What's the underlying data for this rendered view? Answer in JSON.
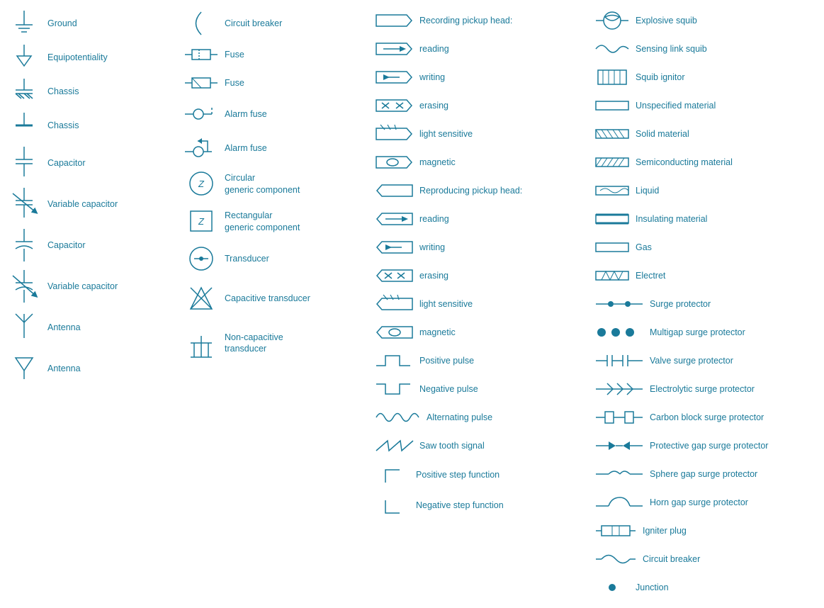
{
  "columns": [
    {
      "items": [
        {
          "label": "Ground",
          "sym": "ground"
        },
        {
          "label": "Equipotentiality",
          "sym": "equipotentiality"
        },
        {
          "label": "Chassis",
          "sym": "chassis1"
        },
        {
          "label": "Chassis",
          "sym": "chassis2"
        },
        {
          "label": "Capacitor",
          "sym": "capacitor"
        },
        {
          "label": "Variable capacitor",
          "sym": "var-capacitor"
        },
        {
          "label": "Capacitor",
          "sym": "capacitor2"
        },
        {
          "label": "Variable capacitor",
          "sym": "var-capacitor2"
        },
        {
          "label": "Antenna",
          "sym": "antenna1"
        },
        {
          "label": "Antenna",
          "sym": "antenna2"
        }
      ]
    },
    {
      "items": [
        {
          "label": "Circuit breaker",
          "sym": "circuit-breaker"
        },
        {
          "label": "Fuse",
          "sym": "fuse1"
        },
        {
          "label": "Fuse",
          "sym": "fuse2"
        },
        {
          "label": "Alarm fuse",
          "sym": "alarm-fuse1"
        },
        {
          "label": "Alarm fuse",
          "sym": "alarm-fuse2"
        },
        {
          "label": "Circular\ngeneric component",
          "sym": "circular-generic"
        },
        {
          "label": "Rectangular\ngeneric component",
          "sym": "rectangular-generic"
        },
        {
          "label": "Transducer",
          "sym": "transducer"
        },
        {
          "label": "Capacitive transducer",
          "sym": "cap-transducer"
        },
        {
          "label": "Non-capacitive\ntransducer",
          "sym": "non-cap-transducer"
        }
      ]
    },
    {
      "items": [
        {
          "label": "Recording pickup head:",
          "sym": "rec-head-title"
        },
        {
          "label": "reading",
          "sym": "rec-reading"
        },
        {
          "label": "writing",
          "sym": "rec-writing"
        },
        {
          "label": "erasing",
          "sym": "rec-erasing"
        },
        {
          "label": "light sensitive",
          "sym": "rec-light"
        },
        {
          "label": "magnetic",
          "sym": "rec-magnetic"
        },
        {
          "label": "Reproducing pickup head:",
          "sym": "rep-head-title"
        },
        {
          "label": "reading",
          "sym": "rep-reading"
        },
        {
          "label": "writing",
          "sym": "rep-writing"
        },
        {
          "label": "erasing",
          "sym": "rep-erasing"
        },
        {
          "label": "light sensitive",
          "sym": "rep-light"
        },
        {
          "label": "magnetic",
          "sym": "rep-magnetic"
        },
        {
          "label": "Positive pulse",
          "sym": "pos-pulse"
        },
        {
          "label": "Negative pulse",
          "sym": "neg-pulse"
        },
        {
          "label": "Alternating pulse",
          "sym": "alt-pulse"
        },
        {
          "label": "Saw tooth signal",
          "sym": "saw-tooth"
        },
        {
          "label": "Positive step function",
          "sym": "pos-step"
        },
        {
          "label": "Negative step function",
          "sym": "neg-step"
        }
      ]
    },
    {
      "items": [
        {
          "label": "Explosive squib",
          "sym": "explosive-squib"
        },
        {
          "label": "Sensing link squib",
          "sym": "sensing-squib"
        },
        {
          "label": "Squib ignitor",
          "sym": "squib-ignitor"
        },
        {
          "label": "Unspecified material",
          "sym": "unspec-material"
        },
        {
          "label": "Solid material",
          "sym": "solid-material"
        },
        {
          "label": "Semiconducting material",
          "sym": "semi-material"
        },
        {
          "label": "Liquid",
          "sym": "liquid"
        },
        {
          "label": "Insulating material",
          "sym": "insulating"
        },
        {
          "label": "Gas",
          "sym": "gas"
        },
        {
          "label": "Electret",
          "sym": "electret"
        },
        {
          "label": "Surge protector",
          "sym": "surge-protector"
        },
        {
          "label": "Multigap surge protector",
          "sym": "multigap-surge"
        },
        {
          "label": "Valve surge protector",
          "sym": "valve-surge"
        },
        {
          "label": "Electrolytic surge protector",
          "sym": "electrolytic-surge"
        },
        {
          "label": "Carbon block surge protector",
          "sym": "carbon-surge"
        },
        {
          "label": "Protective gap surge protector",
          "sym": "protective-surge"
        },
        {
          "label": "Sphere gap surge protector",
          "sym": "sphere-surge"
        },
        {
          "label": "Horn gap surge protector",
          "sym": "horn-surge"
        },
        {
          "label": "Igniter plug",
          "sym": "igniter-plug"
        },
        {
          "label": "Circuit breaker",
          "sym": "circuit-breaker2"
        },
        {
          "label": "Junction",
          "sym": "junction"
        }
      ]
    }
  ]
}
